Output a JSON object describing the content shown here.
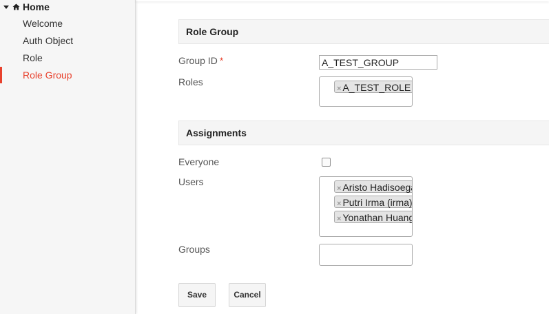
{
  "sidebar": {
    "home_label": "Home",
    "items": [
      {
        "label": "Welcome"
      },
      {
        "label": "Auth Object"
      },
      {
        "label": "Role"
      },
      {
        "label": "Role Group"
      }
    ],
    "active_item": "Role Group",
    "accent_color": "#e8412d"
  },
  "role_group_section": {
    "title": "Role Group",
    "group_id_label": "Group ID",
    "required_mark": "*",
    "group_id_value": "A_TEST_GROUP",
    "roles_label": "Roles",
    "roles": [
      "A_TEST_ROLE"
    ]
  },
  "assignments_section": {
    "title": "Assignments",
    "everyone_label": "Everyone",
    "everyone_checked": false,
    "users_label": "Users",
    "users": [
      "Aristo Hadisoegandi",
      "Putri Irma (irma)",
      "Yonathan Huang"
    ],
    "groups_label": "Groups",
    "groups": []
  },
  "actions": {
    "save_label": "Save",
    "cancel_label": "Cancel"
  },
  "icons": {
    "home": "home-icon",
    "expand": "caret-down-icon",
    "remove": "close-icon"
  },
  "tag_remove_glyph": "×"
}
